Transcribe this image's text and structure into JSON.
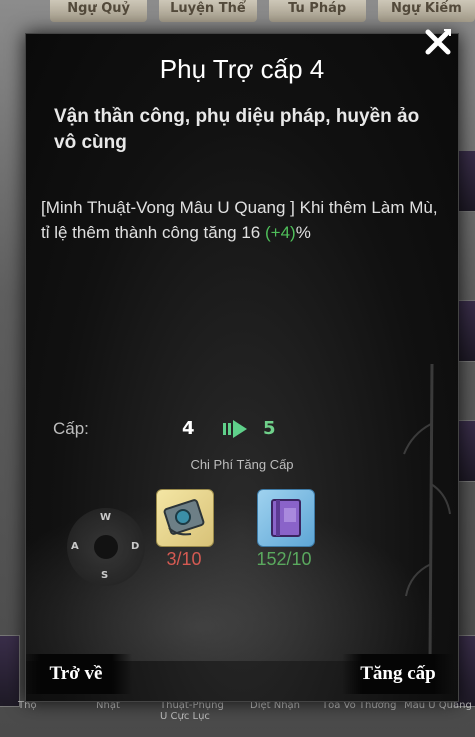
{
  "background": {
    "tabs": [
      "Ngự Quỷ",
      "Luyện Thể",
      "Tu Pháp",
      "Ngự Kiếm"
    ],
    "bottom_labels": [
      "Thọ",
      "Nhật",
      "Thuật-Phụng U Cực Lục",
      "Diệt Nhận",
      "Tỏa Võ Thương",
      "Mâu U Quang"
    ]
  },
  "modal": {
    "title": "Phụ Trợ cấp 4",
    "subtitle": "Vận thần công, phụ diệu pháp, huyền ảo vô cùng",
    "description_main": "[Minh Thuật-Vong Mâu U Quang ] Khi thêm Làm Mù, tỉ lệ thêm thành công tăng 16 ",
    "description_bonus": "(+4)",
    "description_suffix": "%",
    "level_label": "Cấp:",
    "level_from": "4",
    "level_to": "5",
    "cost_title": "Chi Phí Tăng Cấp",
    "joystick": {
      "n": "W",
      "w": "A",
      "e": "D",
      "s": "S"
    },
    "items": [
      {
        "icon": "scroll-book-icon",
        "count": "3/10"
      },
      {
        "icon": "purple-skill-book-icon",
        "count": "152/10"
      }
    ],
    "buttons": {
      "back": "Trở về",
      "upgrade": "Tăng cấp"
    }
  },
  "colors": {
    "bonus": "#4fbf5a",
    "insufficient": "#d45a52",
    "sufficient": "#5aa85e",
    "level_to": "#6fd08a"
  }
}
